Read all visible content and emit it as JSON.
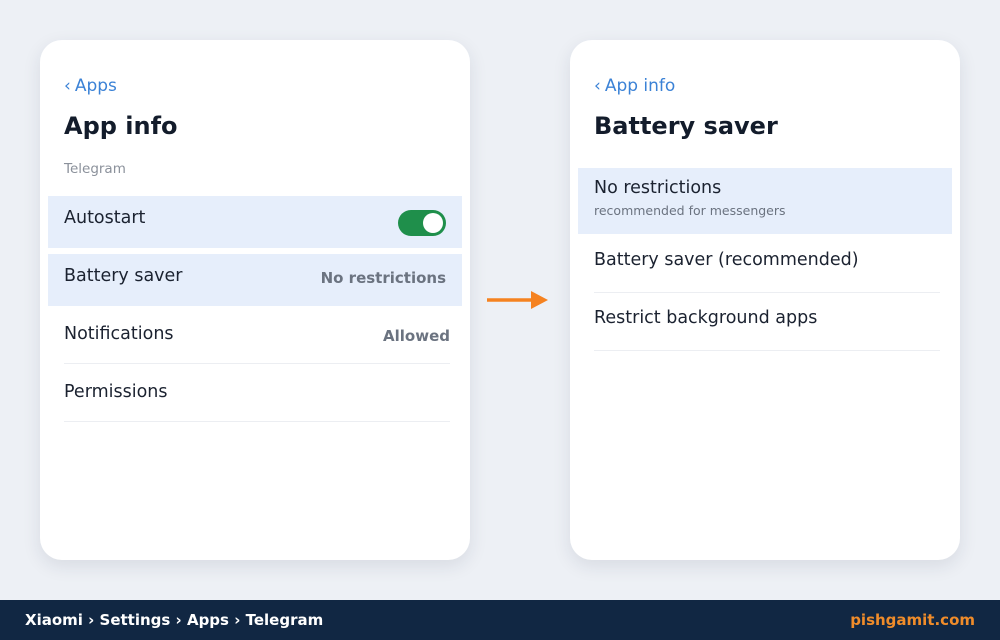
{
  "app_info": {
    "back_label": "Apps",
    "title": "App info",
    "subtitle": "Telegram",
    "rows": [
      {
        "label": "Autostart",
        "toggle_on": true
      },
      {
        "label": "Battery saver",
        "value": "No restrictions"
      },
      {
        "label": "Notifications",
        "value": "Allowed"
      },
      {
        "label": "Permissions"
      }
    ]
  },
  "battery_saver": {
    "back_label": "App info",
    "title": "Battery saver",
    "options": [
      {
        "label": "No restrictions",
        "sublabel": "recommended for messengers",
        "highlighted": true
      },
      {
        "label": "Battery saver (recommended)"
      },
      {
        "label": "Restrict background apps"
      }
    ]
  },
  "footer": {
    "breadcrumb": "Xiaomi › Settings › Apps › Telegram",
    "brand": "pishgamit.com"
  },
  "icons": {
    "back": "chevron-left-icon",
    "flow": "arrow-right-icon"
  },
  "colors": {
    "accent": "#3b82d6",
    "highlight": "#e6eefb",
    "toggle_on": "#1f8f4b",
    "arrow": "#f58220",
    "footer_bg": "#112743",
    "brand": "#f08c2a"
  }
}
